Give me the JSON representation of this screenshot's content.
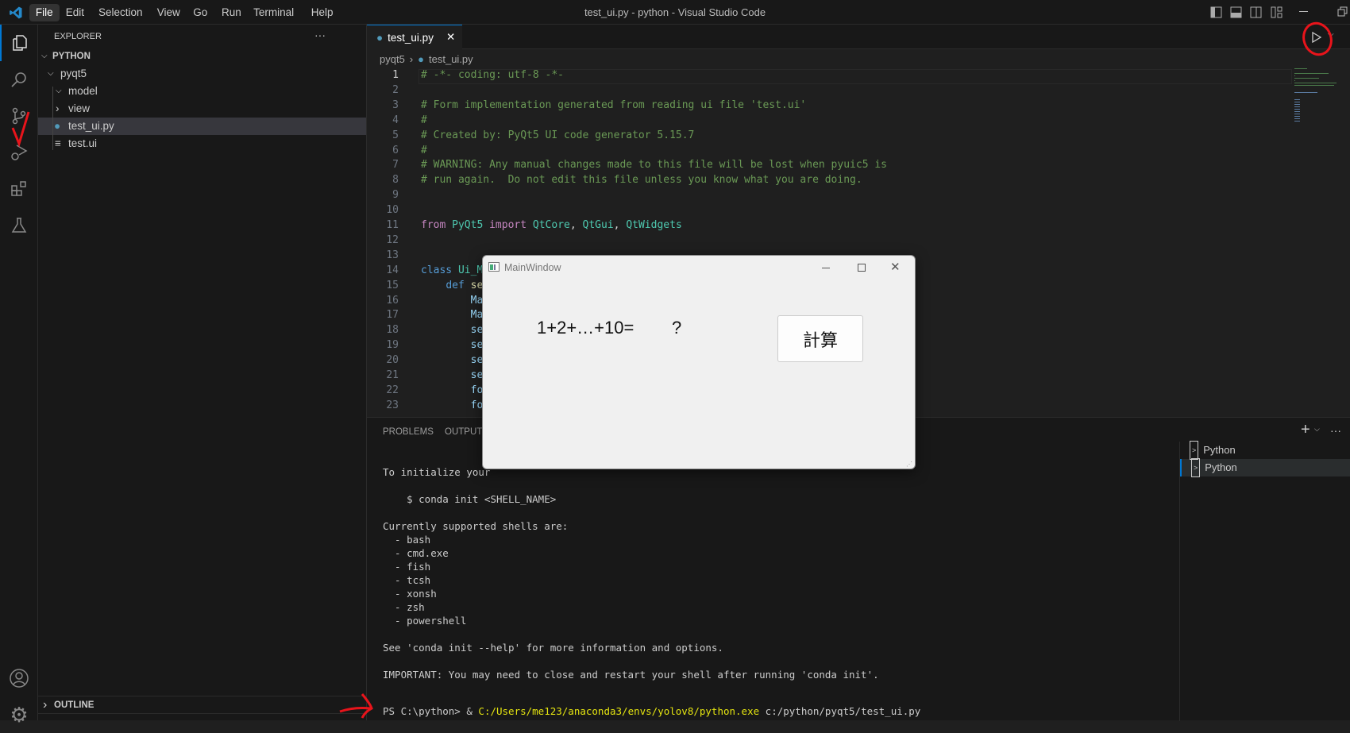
{
  "titlebar": {
    "menus": [
      "File",
      "Edit",
      "Selection",
      "View",
      "Go",
      "Run",
      "Terminal",
      "Help"
    ],
    "title": "test_ui.py - python - Visual Studio Code"
  },
  "sidebar": {
    "title": "EXPLORER",
    "more": "···",
    "root": "PYTHON",
    "items": [
      {
        "label": "pyqt5",
        "type": "folder-open"
      },
      {
        "label": "model",
        "type": "folder-open"
      },
      {
        "label": "view",
        "type": "folder-closed"
      },
      {
        "label": "test_ui.py",
        "type": "python"
      },
      {
        "label": "test.ui",
        "type": "file"
      }
    ],
    "outline": "OUTLINE"
  },
  "editor": {
    "tab": "test_ui.py",
    "breadcrumb": [
      "pyqt5",
      "test_ui.py"
    ],
    "lines": [
      [
        [
          "# -*- coding: utf-8 -*-",
          "com"
        ]
      ],
      [],
      [
        [
          "# Form implementation generated from reading ui file 'test.ui'",
          "com"
        ]
      ],
      [
        [
          "#",
          "com"
        ]
      ],
      [
        [
          "# Created by: PyQt5 UI code generator 5.15.7",
          "com"
        ]
      ],
      [
        [
          "#",
          "com"
        ]
      ],
      [
        [
          "# WARNING: Any manual changes made to this file will be lost when pyuic5 is",
          "com"
        ]
      ],
      [
        [
          "# run again.  Do not edit this file unless you know what you are doing.",
          "com"
        ]
      ],
      [],
      [],
      [
        [
          "from",
          "kw"
        ],
        [
          " ",
          "txt"
        ],
        [
          "PyQt5",
          "mod"
        ],
        [
          " ",
          "txt"
        ],
        [
          "import",
          "kw"
        ],
        [
          " ",
          "txt"
        ],
        [
          "QtCore",
          "mod"
        ],
        [
          ", ",
          "txt"
        ],
        [
          "QtGui",
          "mod"
        ],
        [
          ", ",
          "txt"
        ],
        [
          "QtWidgets",
          "mod"
        ]
      ],
      [],
      [],
      [
        [
          "class",
          "def"
        ],
        [
          " ",
          "txt"
        ],
        [
          "Ui_M",
          "mod"
        ]
      ],
      [
        [
          "    ",
          "txt"
        ],
        [
          "def",
          "def"
        ],
        [
          " ",
          "txt"
        ],
        [
          "se",
          "fn"
        ]
      ],
      [
        [
          "        ",
          "txt"
        ],
        [
          "Ma",
          "var"
        ]
      ],
      [
        [
          "        ",
          "txt"
        ],
        [
          "Ma",
          "var"
        ]
      ],
      [
        [
          "        ",
          "txt"
        ],
        [
          "se",
          "var"
        ]
      ],
      [
        [
          "        ",
          "txt"
        ],
        [
          "se",
          "var"
        ]
      ],
      [
        [
          "        ",
          "txt"
        ],
        [
          "se",
          "var"
        ]
      ],
      [
        [
          "        ",
          "txt"
        ],
        [
          "se",
          "var"
        ]
      ],
      [
        [
          "        ",
          "txt"
        ],
        [
          "fo",
          "var"
        ]
      ],
      [
        [
          "        ",
          "txt"
        ],
        [
          "fo",
          "var"
        ]
      ]
    ]
  },
  "panel": {
    "tabs": [
      "PROBLEMS",
      "OUTPUT"
    ],
    "terminal_lines": [
      {
        "t": "To initialize your"
      },
      {
        "t": ""
      },
      {
        "t": "    $ conda init <SHELL_NAME>"
      },
      {
        "t": ""
      },
      {
        "t": "Currently supported shells are:"
      },
      {
        "t": "  - bash"
      },
      {
        "t": "  - cmd.exe"
      },
      {
        "t": "  - fish"
      },
      {
        "t": "  - tcsh"
      },
      {
        "t": "  - xonsh"
      },
      {
        "t": "  - zsh"
      },
      {
        "t": "  - powershell"
      },
      {
        "t": ""
      },
      {
        "t": "See 'conda init --help' for more information and options."
      },
      {
        "t": ""
      },
      {
        "t": "IMPORTANT: You may need to close and restart your shell after running 'conda init'."
      },
      {
        "t": ""
      },
      {
        "t": ""
      }
    ],
    "prompt": "PS C:\\python> & ",
    "exe": "C:/Users/me123/anaconda3/envs/yolov8/python.exe",
    "arg": " c:/python/pyqt5/test_ui.py",
    "terminals": [
      "Python",
      "Python"
    ],
    "add": "+",
    "more": "···"
  },
  "qtwindow": {
    "title": "MainWindow",
    "label": "1+2+…+10=",
    "result": "?",
    "button": "計算"
  },
  "colors": {
    "accent": "#0078d4",
    "annotation": "#e8141b"
  }
}
